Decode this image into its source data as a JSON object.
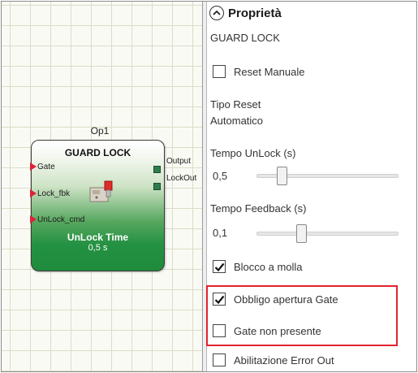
{
  "canvas": {
    "block": {
      "caption": "Op1",
      "title": "GUARD LOCK",
      "inputs": [
        "Gate",
        "Lock_fbk",
        "UnLock_cmd"
      ],
      "outputs": [
        "Output",
        "LockOut"
      ],
      "param_label": "UnLock Time",
      "param_value": "0,5 s",
      "icon": "door-lock-icon"
    }
  },
  "panel": {
    "section_title": "Proprietà",
    "section_toggle_icon": "chevron-up-icon",
    "subtitle": "GUARD LOCK",
    "reset_manuale": {
      "label": "Reset Manuale",
      "checked": false
    },
    "tipo_reset": {
      "label": "Tipo Reset",
      "value": "Automatico"
    },
    "tempo_unlock": {
      "label": "Tempo UnLock (s)",
      "value": "0,5",
      "level": 0.15
    },
    "tempo_feedback": {
      "label": "Tempo Feedback (s)",
      "value": "0,1",
      "level": 0.3
    },
    "blocco_molla": {
      "label": "Blocco a molla",
      "checked": true
    },
    "obbligo_apertura": {
      "label": "Obbligo apertura Gate",
      "checked": true
    },
    "gate_non_presente": {
      "label": "Gate non presente",
      "checked": false
    },
    "abilitazione_error": {
      "label": "Abilitazione Error Out",
      "checked": false
    }
  },
  "colors": {
    "highlight": "#e2232e",
    "pin_input": "#e0203a",
    "pin_output": "#2e7d4f",
    "block_green": "#239142"
  }
}
